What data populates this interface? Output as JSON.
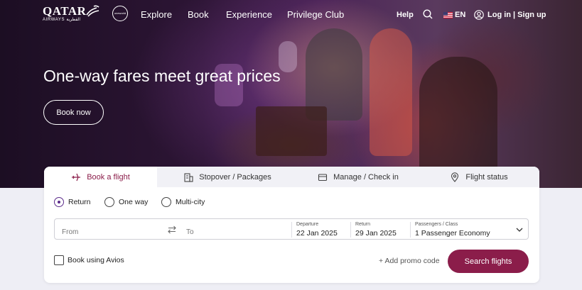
{
  "brand": {
    "name": "QATAR",
    "sub": "AIRWAYS القطرية"
  },
  "nav": {
    "links": [
      "Explore",
      "Book",
      "Experience",
      "Privilege Club"
    ],
    "help": "Help",
    "language": "EN",
    "login": "Log in | Sign up"
  },
  "hero": {
    "headline": "One-way fares meet great prices",
    "cta": "Book now"
  },
  "booking": {
    "tabs": [
      {
        "label": "Book a flight",
        "icon": "plane-icon",
        "active": true
      },
      {
        "label": "Stopover / Packages",
        "icon": "hotel-icon",
        "active": false
      },
      {
        "label": "Manage / Check in",
        "icon": "card-icon",
        "active": false
      },
      {
        "label": "Flight status",
        "icon": "pin-icon",
        "active": false
      }
    ],
    "trip_types": [
      {
        "label": "Return",
        "selected": true
      },
      {
        "label": "One way",
        "selected": false
      },
      {
        "label": "Multi-city",
        "selected": false
      }
    ],
    "from_placeholder": "From",
    "to_placeholder": "To",
    "departure_label": "Departure",
    "departure_value": "22 Jan 2025",
    "return_label": "Return",
    "return_value": "29 Jan 2025",
    "pax_label": "Passengers / Class",
    "pax_value": "1 Passenger Economy",
    "avios_label": "Book using Avios",
    "promo_label": "Add promo code",
    "search_label": "Search flights"
  },
  "colors": {
    "accent": "#8b1d4a",
    "radio": "#5b2b8a"
  }
}
